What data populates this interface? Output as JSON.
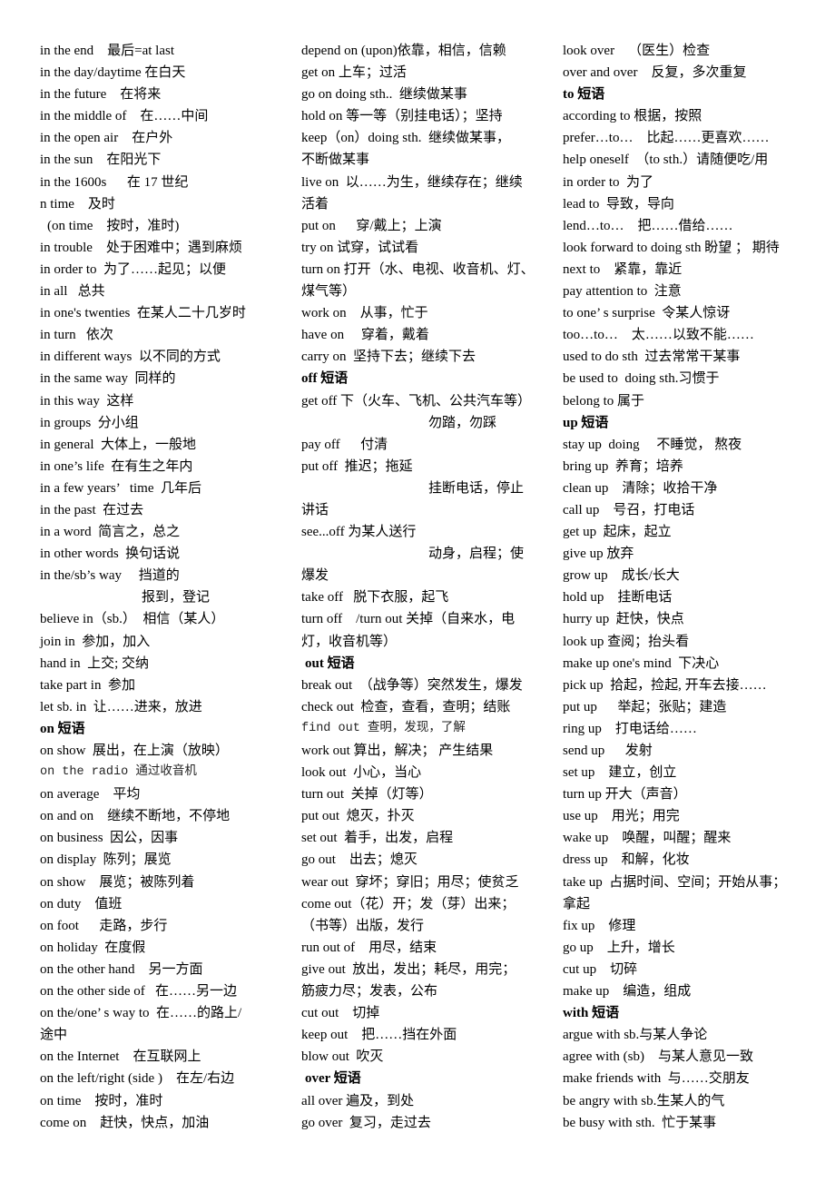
{
  "columns": [
    {
      "lines": [
        {
          "text": "in the end    最后=at last"
        },
        {
          "text": "in the day/daytime 在白天"
        },
        {
          "text": "in the future    在将来"
        },
        {
          "text": "in the middle of    在……中间"
        },
        {
          "text": "in the open air    在户外"
        },
        {
          "text": "in the sun    在阳光下"
        },
        {
          "text": "in the 1600s      在 17 世纪"
        },
        {
          "text": "n time    及时"
        },
        {
          "text": "(on time    按时，准时)",
          "style": "sp1"
        },
        {
          "text": "in trouble    处于困难中；遇到麻烦"
        },
        {
          "text": "in order to  为了……起见；以便"
        },
        {
          "text": "in all   总共"
        },
        {
          "text": "in one's twenties  在某人二十几岁时"
        },
        {
          "text": "in turn   依次"
        },
        {
          "text": "in different ways  以不同的方式"
        },
        {
          "text": "in the same way  同样的"
        },
        {
          "text": "in this way  这样"
        },
        {
          "text": "in groups  分小组"
        },
        {
          "text": "in general  大体上，一般地"
        },
        {
          "text": "in one’s life  在有生之年内"
        },
        {
          "text": "in a few years’   time  几年后"
        },
        {
          "text": "in the past  在过去"
        },
        {
          "text": "in a word  简言之，总之"
        },
        {
          "text": "in other words  换句话说"
        },
        {
          "text": "in the/sb’s way     挡道的"
        },
        {
          "text": "报到，登记",
          "style": "indent"
        },
        {
          "text": "believe in（sb.）  相信（某人）"
        },
        {
          "text": "join in  参加，加入"
        },
        {
          "text": "hand in  上交; 交纳"
        },
        {
          "text": "take part in  参加"
        },
        {
          "text": "let sb. in  让……进来，放进"
        },
        {
          "text": "on 短语",
          "style": "head"
        },
        {
          "text": "on show  展出，在上演（放映）"
        },
        {
          "text": "on the radio 通过收音机",
          "style": "mono"
        },
        {
          "text": "on average    平均"
        },
        {
          "text": "on and on    继续不断地，不停地"
        },
        {
          "text": "on business  因公，因事"
        },
        {
          "text": "on display  陈列；展览"
        },
        {
          "text": "on show    展览；被陈列着"
        },
        {
          "text": "on duty    值班"
        },
        {
          "text": "on foot      走路，步行"
        },
        {
          "text": "on holiday  在度假"
        },
        {
          "text": "on the other hand    另一方面"
        },
        {
          "text": "on the other side of   在……另一边"
        },
        {
          "text": "on the/one’ s way to  在……的路上/"
        },
        {
          "text": "途中"
        },
        {
          "text": "on the Internet    在互联网上"
        },
        {
          "text": "on the left/right (side )    在左/右边"
        },
        {
          "text": "on time    按时，准时"
        },
        {
          "text": "come on    赶快，快点，加油"
        }
      ]
    },
    {
      "lines": [
        {
          "text": "depend on (upon)依靠，相信，信赖"
        },
        {
          "text": "get on 上车；过活"
        },
        {
          "text": "go on doing sth..  继续做某事"
        },
        {
          "text": "hold on 等一等（别挂电话）；坚持"
        },
        {
          "text": "keep（on）doing sth.  继续做某事，"
        },
        {
          "text": "不断做某事"
        },
        {
          "text": "live on  以……为生，继续存在；继续"
        },
        {
          "text": "活着"
        },
        {
          "text": "put on      穿/戴上；上演"
        },
        {
          "text": "try on 试穿，试试看"
        },
        {
          "text": "turn on 打开（水、电视、收音机、灯、"
        },
        {
          "text": "煤气等）"
        },
        {
          "text": "work on    从事，忙于"
        },
        {
          "text": "have on     穿着，戴着"
        },
        {
          "text": "carry on  坚持下去；继续下去"
        },
        {
          "text": "off 短语",
          "style": "head"
        },
        {
          "text": "get off 下（火车、飞机、公共汽车等）"
        },
        {
          "text": "勿踏，勿踩",
          "style": "indent2"
        },
        {
          "text": "pay off      付清"
        },
        {
          "text": "put off  推迟；拖延"
        },
        {
          "text": "挂断电话，停止",
          "style": "indent2"
        },
        {
          "text": "讲话"
        },
        {
          "text": "see...off 为某人送行"
        },
        {
          "text": "动身，启程；使",
          "style": "indent2"
        },
        {
          "text": "爆发"
        },
        {
          "text": "take off   脱下衣服，起飞"
        },
        {
          "text": "turn off    /turn out 关掉（自来水，电"
        },
        {
          "text": "灯，收音机等）"
        },
        {
          "text": "out 短语",
          "style": "head sp2"
        },
        {
          "text": "break out  （战争等）突然发生，爆发"
        },
        {
          "text": "check out  检查，查看，查明；结账"
        },
        {
          "text": "find out 查明，发现，了解",
          "style": "mono"
        },
        {
          "text": "work out 算出，解决； 产生结果"
        },
        {
          "text": "look out  小心，当心"
        },
        {
          "text": "turn out  关掉（灯等）"
        },
        {
          "text": "put out  熄灭，扑灭"
        },
        {
          "text": "set out  着手，出发，启程"
        },
        {
          "text": "go out    出去；熄灭"
        },
        {
          "text": "wear out  穿坏；穿旧；用尽；使贫乏"
        },
        {
          "text": "come out（花）开；发（芽）出来；"
        },
        {
          "text": "（书等）出版，发行"
        },
        {
          "text": "run out of    用尽，结束"
        },
        {
          "text": "give out  放出，发出；耗尽，用完；"
        },
        {
          "text": "筋疲力尽；发表，公布"
        },
        {
          "text": "cut out    切掉"
        },
        {
          "text": "keep out    把……挡在外面"
        },
        {
          "text": "blow out  吹灭"
        },
        {
          "text": "over 短语",
          "style": "head sp2"
        },
        {
          "text": "all over 遍及，到处"
        },
        {
          "text": "go over  复习，走过去"
        }
      ]
    },
    {
      "lines": [
        {
          "text": "look over    （医生）检查"
        },
        {
          "text": "over and over    反复，多次重复"
        },
        {
          "text": "to 短语",
          "style": "head"
        },
        {
          "text": "according to 根据，按照"
        },
        {
          "text": "prefer…to…    比起……更喜欢……"
        },
        {
          "text": "help oneself  （to sth.）请随便吃/用"
        },
        {
          "text": "in order to  为了"
        },
        {
          "text": "lead to  导致，导向"
        },
        {
          "text": "lend…to…    把……借给……"
        },
        {
          "text": "look forward to doing sth 盼望 ； 期待"
        },
        {
          "text": "next to    紧靠，靠近"
        },
        {
          "text": "pay attention to  注意"
        },
        {
          "text": "to one’ s surprise  令某人惊讶"
        },
        {
          "text": "too…to…    太……以致不能……"
        },
        {
          "text": "used to do sth  过去常常干某事"
        },
        {
          "text": "be used to  doing sth.习惯于"
        },
        {
          "text": "belong to 属于"
        },
        {
          "text": "up 短语",
          "style": "head"
        },
        {
          "text": "stay up  doing     不睡觉， 熬夜"
        },
        {
          "text": "bring up  养育；培养"
        },
        {
          "text": "clean up    清除；收拾干净"
        },
        {
          "text": "call up    号召，打电话"
        },
        {
          "text": "get up  起床，起立"
        },
        {
          "text": "give up 放弃"
        },
        {
          "text": "grow up    成长/长大"
        },
        {
          "text": "hold up    挂断电话"
        },
        {
          "text": "hurry up  赶快，快点"
        },
        {
          "text": "look up 查阅；抬头看"
        },
        {
          "text": "make up one's mind  下决心"
        },
        {
          "text": "pick up  拾起，捡起, 开车去接……"
        },
        {
          "text": "put up      举起；张贴；建造"
        },
        {
          "text": "ring up    打电话给……"
        },
        {
          "text": "send up      发射"
        },
        {
          "text": "set up    建立，创立"
        },
        {
          "text": "turn up 开大（声音）"
        },
        {
          "text": "use up    用光；用完"
        },
        {
          "text": "wake up    唤醒，叫醒；醒来"
        },
        {
          "text": "dress up    和解，化妆"
        },
        {
          "text": "take up  占据时间、空间；开始从事；"
        },
        {
          "text": "拿起"
        },
        {
          "text": "fix up    修理"
        },
        {
          "text": "go up    上升，增长"
        },
        {
          "text": "cut up    切碎"
        },
        {
          "text": "make up    编造，组成"
        },
        {
          "text": "with 短语",
          "style": "head"
        },
        {
          "text": "argue with sb.与某人争论"
        },
        {
          "text": "agree with (sb)    与某人意见一致"
        },
        {
          "text": "make friends with  与……交朋友"
        },
        {
          "text": "be angry with sb.生某人的气"
        },
        {
          "text": "be busy with sth.  忙于某事"
        }
      ]
    }
  ]
}
